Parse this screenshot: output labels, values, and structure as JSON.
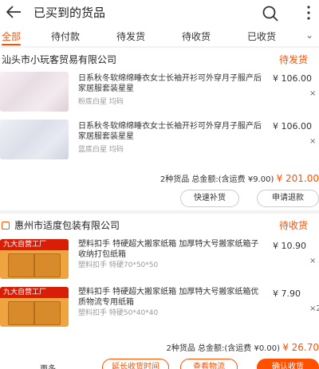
{
  "header": {
    "title": "已买到的货品"
  },
  "tabs": [
    "全部",
    "待付款",
    "待发货",
    "待收货",
    "已收货"
  ],
  "orders": [
    {
      "shop": "汕头市小玩客贸易有限公司",
      "status": "待发货",
      "items": [
        {
          "title": "日系秋冬软绵绵睡衣女士长袖开衫可外穿月子服产后家居服套装星星",
          "spec": "粉底白星 均码",
          "price": "¥ 106.00",
          "qty": "×"
        },
        {
          "title": "日系秋冬软绵绵睡衣女士长袖开衫可外穿月子服产后家居服套装星星",
          "spec": "蓝底白星 均码",
          "price": "¥ 106.00",
          "qty": "×"
        }
      ],
      "summary_prefix": "2种货品 总金额:(含运费 ¥9.00)",
      "summary_total": "¥ 201.00",
      "buttons": [
        "快速补货",
        "申请退款"
      ]
    },
    {
      "shop": "惠州市适度包装有限公司",
      "status": "待收货",
      "items": [
        {
          "title": "塑料扣手 特硬超大搬家纸箱 加厚特大号搬家纸箱子收纳打包纸箱",
          "spec": "塑料扣手 特硬70*50*50",
          "price": "¥ 10.90",
          "qty": "×"
        },
        {
          "title": "塑料扣手 特硬超大搬家纸箱 加厚特大号搬家纸箱优质物流专用纸箱",
          "spec": "塑料扣手 特硬50*40*40",
          "price": "¥ 7.90",
          "qty": "×2"
        }
      ],
      "summary_prefix": "2种货品 总金额:(含运费 ¥0.00)",
      "summary_total": "¥ 26.70",
      "more": "更多",
      "buttons": [
        "延长收货时间",
        "查看物流",
        "确认收货"
      ]
    }
  ],
  "thumb_banner": "九大自营工厂"
}
